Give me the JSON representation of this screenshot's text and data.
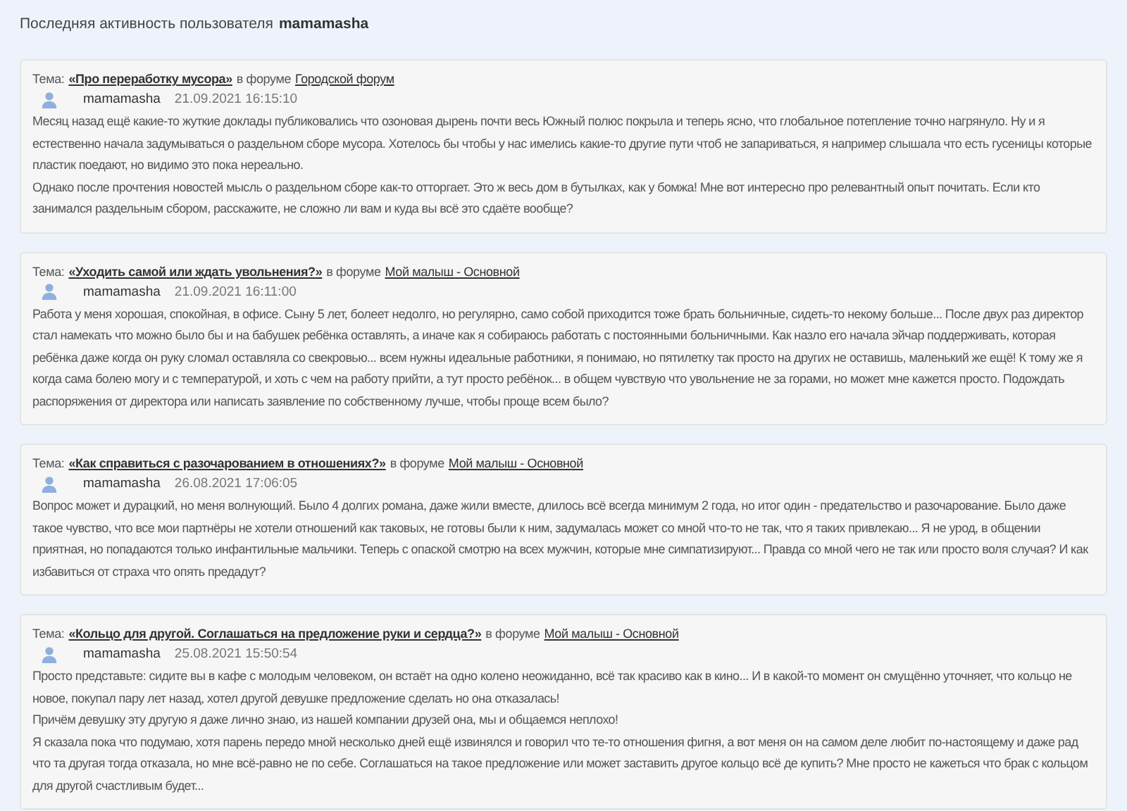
{
  "header": {
    "text": "Последняя активность пользователя",
    "username": "mamamasha"
  },
  "posts": [
    {
      "topic_label": "Тема:",
      "topic": "«Про переработку мусора»",
      "forum_label": "в форуме",
      "forum": "Городской форум",
      "author": "mamamasha",
      "date": "21.09.2021 16:15:10",
      "paragraphs": [
        "Месяц назад ещё какие-то жуткие доклады публиковались что озоновая дырень почти весь Южный полюс покрыла и теперь ясно, что глобальное потепление точно нагрянуло. Ну и я естественно начала задумываться о раздельном сборе мусора. Хотелось бы чтобы у нас имелись какие-то другие пути чтоб не запариваться, я например слышала что есть гусеницы которые пластик поедают, но видимо это пока нереально.",
        "Однако после прочтения новостей мысль о раздельном сборе как-то отторгает. Это ж весь дом в бутылках, как у бомжа! Мне вот интересно про релевантный опыт почитать. Если кто занимался раздельным сбором, расскажите, не сложно ли вам и куда вы всё это сдаёте вообще?"
      ]
    },
    {
      "topic_label": "Тема:",
      "topic": "«Уходить самой или ждать увольнения?»",
      "forum_label": "в форуме",
      "forum": "Мой малыш - Основной",
      "author": "mamamasha",
      "date": "21.09.2021 16:11:00",
      "paragraphs": [
        "Работа у меня хорошая, спокойная, в офисе. Сыну 5 лет, болеет недолго, но регулярно, само собой приходится тоже брать больничные, сидеть-то некому больше... После двух раз директор стал намекать что можно было бы и на бабушек ребёнка оставлять, а иначе как я собираюсь работать с постоянными больничными. Как назло его начала эйчар поддерживать, которая ребёнка даже когда он руку сломал оставляла со свекровью... всем нужны идеальные работники, я понимаю, но пятилетку так просто на других не оставишь, маленький же ещё! К тому же я когда сама болею могу и с температурой, и хоть с чем на работу прийти, а тут просто ребёнок... в общем чувствую что увольнение не за горами, но может мне кажется просто. Подождать распоряжения от директора или написать заявление по собственному лучше, чтобы проще всем было?"
      ]
    },
    {
      "topic_label": "Тема:",
      "topic": "«Как справиться с разочарованием в отношениях?»",
      "forum_label": "в форуме",
      "forum": "Мой малыш - Основной",
      "author": "mamamasha",
      "date": "26.08.2021 17:06:05",
      "paragraphs": [
        "Вопрос может и дурацкий, но меня волнующий. Было 4 долгих романа, даже жили вместе, длилось всё всегда минимум 2 года, но итог один - предательство и разочарование. Было даже такое чувство, что все мои партнёры не хотели отношений как таковых, не готовы были к ним, задумалась может со мной что-то не так, что я таких привлекаю... Я не урод, в общении приятная, но попадаются только инфантильные мальчики. Теперь с опаской смотрю на всех мужчин, которые мне симпатизируют... Правда со мной чего не так или просто воля случая? И как избавиться от страха что опять предадут?"
      ]
    },
    {
      "topic_label": "Тема:",
      "topic": "«Кольцо для другой. Соглашаться на предложение руки и сердца?»",
      "forum_label": "в форуме",
      "forum": "Мой малыш - Основной",
      "author": "mamamasha",
      "date": "25.08.2021 15:50:54",
      "paragraphs": [
        "Просто представьте: сидите вы в кафе с молодым человеком, он встаёт на одно колено неожиданно, всё так красиво как в кино... И в какой-то момент он смущённо уточняет, что кольцо не новое, покупал пару лет назад, хотел другой девушке предложение сделать но она отказалась!",
        "Причём девушку эту другую я даже лично знаю, из нашей компании друзей она, мы и общаемся неплохо!",
        "Я сказала пока что подумаю, хотя парень передо мной несколько дней ещё извинялся и говорил что те-то отношения фигня, а вот меня он на самом деле любит по-настоящему и даже рад что та другая тогда отказала, но мне всё-равно не по себе. Соглашаться на такое предложение или может заставить другое кольцо всё де купить? Мне просто не кажеться что брак с кольцом для другой счастливым будет..."
      ]
    }
  ]
}
